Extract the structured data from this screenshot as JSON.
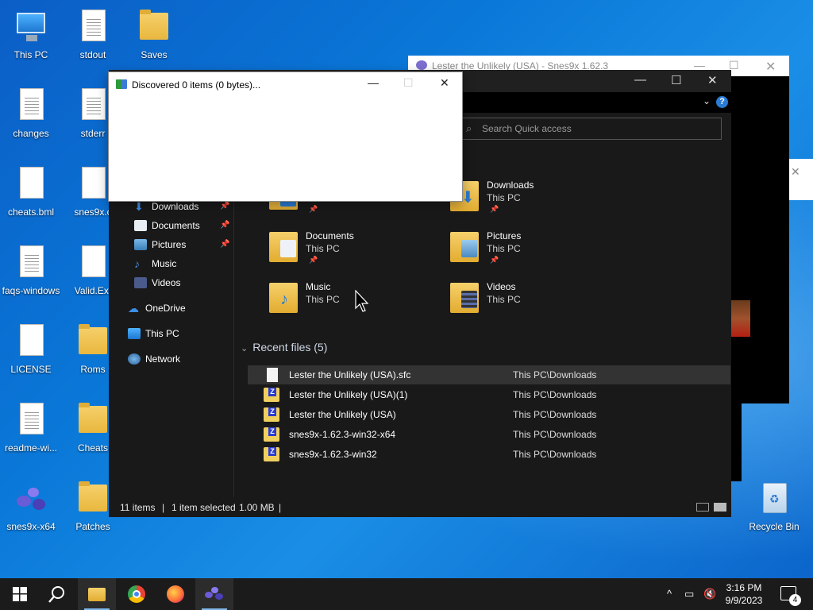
{
  "desktop": {
    "icons": [
      {
        "label": "This PC"
      },
      {
        "label": "stdout"
      },
      {
        "label": "Saves"
      },
      {
        "label": "changes"
      },
      {
        "label": "stderr"
      },
      {
        "label": "cheats.bml"
      },
      {
        "label": "snes9x.c"
      },
      {
        "label": "faqs-windows"
      },
      {
        "label": "Valid.Ext"
      },
      {
        "label": "LICENSE"
      },
      {
        "label": "Roms"
      },
      {
        "label": "readme-wi..."
      },
      {
        "label": "Cheats"
      },
      {
        "label": "snes9x-x64"
      },
      {
        "label": "Patches"
      },
      {
        "label": "Recycle Bin"
      }
    ]
  },
  "snes_window": {
    "title": "Lester the Unlikely (USA) - Snes9x 1.62.3"
  },
  "explorer": {
    "search_placeholder": "Search Quick access",
    "nav": [
      {
        "label": "Downloads",
        "pinned": true
      },
      {
        "label": "Documents",
        "pinned": true
      },
      {
        "label": "Pictures",
        "pinned": true
      },
      {
        "label": "Music",
        "pinned": false
      },
      {
        "label": "Videos",
        "pinned": false
      },
      {
        "label": "OneDrive"
      },
      {
        "label": "This PC"
      },
      {
        "label": "Network"
      }
    ],
    "quick_access": [
      {
        "name": "Downloads",
        "sub": "This PC",
        "pinned": true
      },
      {
        "name": "Documents",
        "sub": "This PC",
        "pinned": true
      },
      {
        "name": "Pictures",
        "sub": "This PC",
        "pinned": true
      },
      {
        "name": "Music",
        "sub": "This PC",
        "pinned": false
      },
      {
        "name": "Videos",
        "sub": "This PC",
        "pinned": false
      }
    ],
    "recent_header": "Recent files (5)",
    "recent_files": [
      {
        "name": "Lester the Unlikely (USA).sfc",
        "location": "This PC\\Downloads",
        "type": "sfc",
        "selected": true
      },
      {
        "name": "Lester the Unlikely (USA)(1)",
        "location": "This PC\\Downloads",
        "type": "zip"
      },
      {
        "name": "Lester the Unlikely (USA)",
        "location": "This PC\\Downloads",
        "type": "zip"
      },
      {
        "name": "snes9x-1.62.3-win32-x64",
        "location": "This PC\\Downloads",
        "type": "zip"
      },
      {
        "name": "snes9x-1.62.3-win32",
        "location": "This PC\\Downloads",
        "type": "zip"
      }
    ],
    "status": {
      "items": "11 items",
      "sep1": "|",
      "selected": "1 item selected",
      "size": "1.00 MB",
      "sep2": "|"
    }
  },
  "dialog": {
    "title": "Discovered 0 items (0 bytes)..."
  },
  "taskbar": {
    "clock_time": "3:16 PM",
    "clock_date": "9/9/2023",
    "notification_count": "4"
  },
  "colors": {
    "desktop_blue": "#0a78d8",
    "explorer_bg": "#191919",
    "accent": "#2a7bd4"
  }
}
